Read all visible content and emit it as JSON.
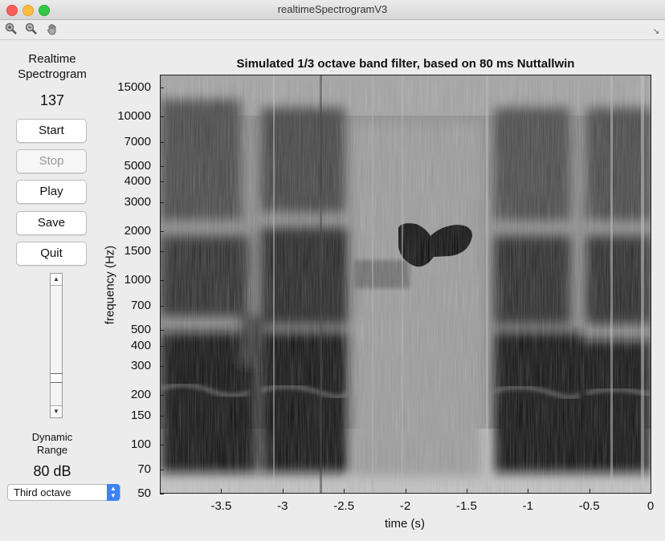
{
  "window": {
    "title": "realtimeSpectrogramV3"
  },
  "toolbar": {
    "icons": [
      "zoom-in-icon",
      "zoom-out-icon",
      "pan-hand-icon"
    ]
  },
  "panel": {
    "title_line1": "Realtime",
    "title_line2": "Spectrogram",
    "counter": "137",
    "buttons": {
      "start": "Start",
      "stop": "Stop",
      "play": "Play",
      "save": "Save",
      "quit": "Quit"
    },
    "stop_disabled": true,
    "dynamic_range_label_line1": "Dynamic",
    "dynamic_range_label_line2": "Range",
    "dynamic_range_value": "80 dB",
    "filter_select": "Third octave"
  },
  "chart_data": {
    "type": "heatmap",
    "title": "Simulated 1/3 octave band filter, based on 80 ms Nuttallwin",
    "xlabel": "time (s)",
    "ylabel": "frequency (Hz)",
    "xlim": [
      -4.0,
      0
    ],
    "ylim": [
      50,
      18000
    ],
    "y_scale": "log",
    "colormap": "gray",
    "xticks": [
      -3.5,
      -3,
      -2.5,
      -2,
      -1.5,
      -1,
      -0.5,
      0
    ],
    "xtick_labels": [
      "-3.5",
      "-3",
      "-2.5",
      "-2",
      "-1.5",
      "-1",
      "-0.5",
      "0"
    ],
    "yticks": [
      50,
      70,
      100,
      150,
      200,
      300,
      400,
      500,
      700,
      1000,
      1500,
      2000,
      3000,
      4000,
      5000,
      7000,
      10000,
      15000
    ],
    "ytick_labels": [
      "50",
      "70",
      "100",
      "150",
      "200",
      "300",
      "400",
      "500",
      "700",
      "1000",
      "1500",
      "2000",
      "3000",
      "4000",
      "5000",
      "7000",
      "10000",
      "15000"
    ]
  }
}
